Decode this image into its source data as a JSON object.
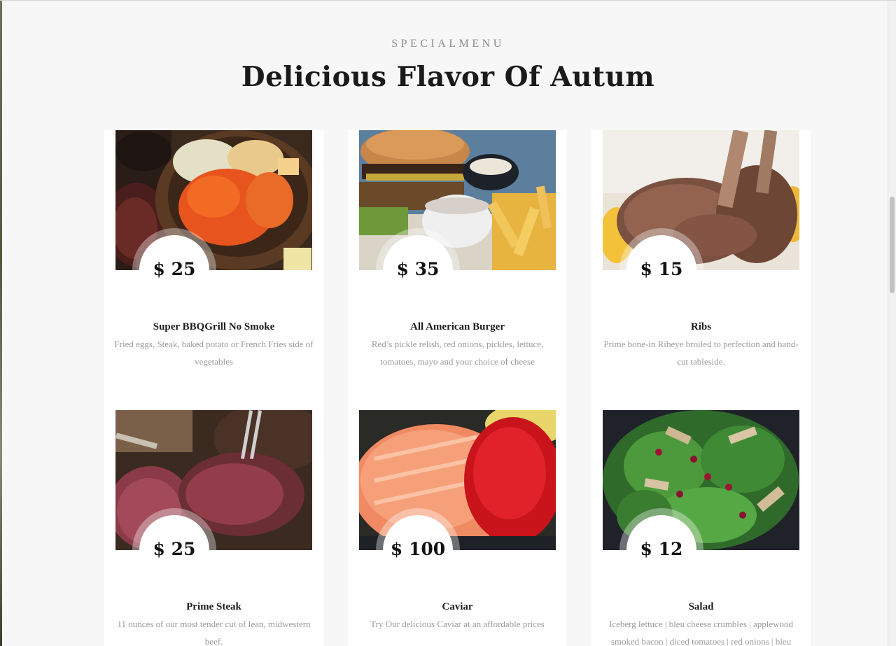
{
  "section": {
    "eyebrow": "SPECIALMENU",
    "title": "Delicious Flavor Of Autum"
  },
  "menu": {
    "items": [
      {
        "price": "$ 25",
        "name": "Super BBQGrill No Smoke",
        "description": "Fried eggs, Steak, baked potato or French Fries side of vegetables",
        "image_icon": "grilled-vegetables-image"
      },
      {
        "price": "$ 35",
        "name": "All American Burger",
        "description": "Red’s pickle relish, red onions, pickles, lettuce, tomatoes, mayo and your choice of cheese",
        "image_icon": "burger-fries-image"
      },
      {
        "price": "$ 15",
        "name": "Ribs",
        "description": "Prime bone-in Ribeye broiled to perfection and hand-cut tableside.",
        "image_icon": "ribs-image"
      },
      {
        "price": "$ 25",
        "name": "Prime Steak",
        "description": "11 ounces of our most tender cut of lean, midwestern beef.",
        "image_icon": "steak-image"
      },
      {
        "price": "$ 100",
        "name": "Caviar",
        "description": "Try Our delicious Caviar at an affordable prices",
        "image_icon": "salmon-caviar-image"
      },
      {
        "price": "$ 12",
        "name": "Salad",
        "description": "Iceberg lettuce | bleu cheese crumbles | applewood smoked bacon | diced tomatoes | red onions | bleu",
        "image_icon": "spinach-salad-image"
      }
    ]
  },
  "colors": {
    "background": "#f7f7f7",
    "card": "#ffffff",
    "title": "#1a1a1a",
    "muted_text": "#9a9a9a"
  }
}
